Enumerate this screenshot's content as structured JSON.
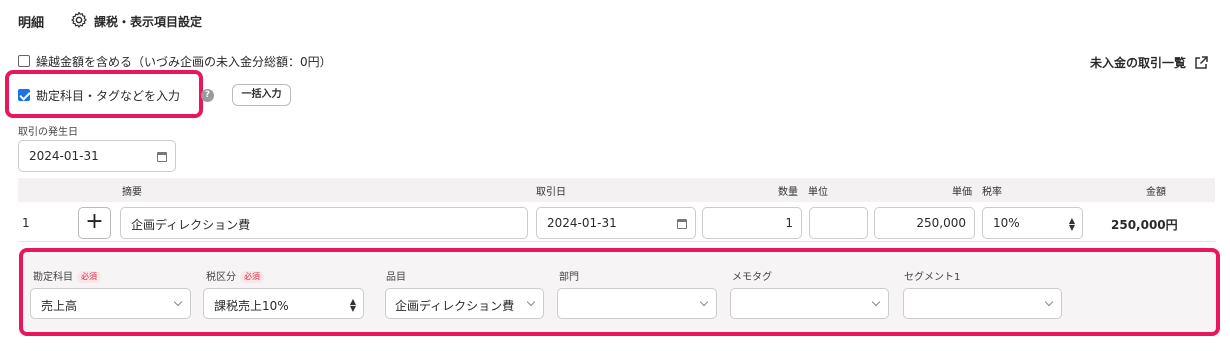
{
  "header": {
    "title": "明細",
    "settings_label": "課税・表示項目設定"
  },
  "options": {
    "include_carryover_label": "繰越金額を含める（いづみ企画の未入金分総額：0円）",
    "include_carryover_checked": false,
    "enter_accounts_label": "勘定科目・タグなどを入力",
    "enter_accounts_checked": true,
    "help_icon_glyph": "?",
    "bulk_input_label": "一括入力"
  },
  "unpaid_link": {
    "label": "未入金の取引一覧"
  },
  "transaction_date": {
    "label": "取引の発生日",
    "value": "2024-01-31"
  },
  "table": {
    "headers": {
      "description": "摘要",
      "date": "取引日",
      "quantity": "数量",
      "unit": "単位",
      "unit_price": "単価",
      "tax_rate": "税率",
      "amount": "金額"
    },
    "rows": [
      {
        "no": "1",
        "add_glyph": "+",
        "description": "企画ディレクション費",
        "date": "2024-01-31",
        "quantity": "1",
        "unit": "",
        "unit_price": "250,000",
        "tax_rate": "10%",
        "amount": "250,000円"
      }
    ]
  },
  "details": {
    "required_badge": "必須",
    "account": {
      "label": "勘定科目",
      "value": "売上高"
    },
    "tax_category": {
      "label": "税区分",
      "value": "課税売上10%"
    },
    "item": {
      "label": "品目",
      "value": "企画ディレクション費"
    },
    "department": {
      "label": "部門",
      "value": ""
    },
    "memo_tag": {
      "label": "メモタグ",
      "value": ""
    },
    "segment1": {
      "label": "セグメント1",
      "value": ""
    }
  },
  "colors": {
    "highlight": "#e8175d",
    "checkbox_accent": "#1a73e8",
    "required_text": "#d0304b"
  }
}
